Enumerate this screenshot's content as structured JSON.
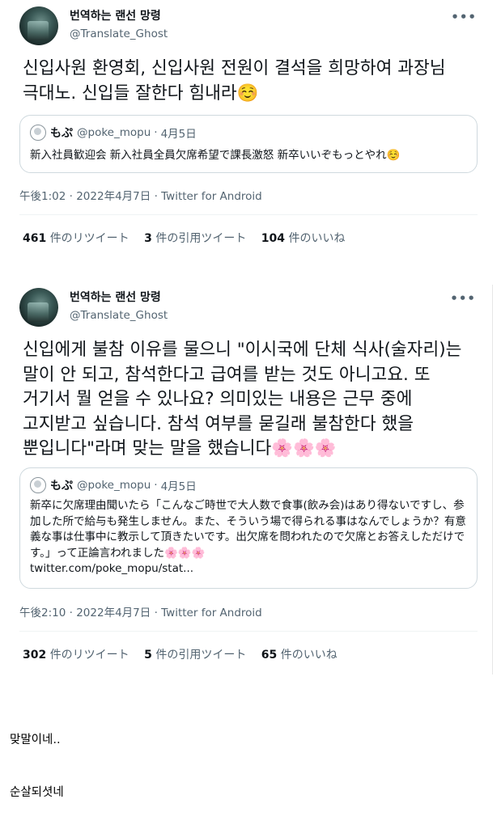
{
  "tweets": [
    {
      "display_name": "번역하는 랜선 망령",
      "handle": "@Translate_Ghost",
      "more_icon": "more-horizontal-icon",
      "more_glyph": "•••",
      "text": "신입사원 환영회, 신입사원 전원이 결석을 희망하여 과장님 극대노. 신입들 잘한다 힘내라",
      "text_emoji": "☺️",
      "quote": {
        "name": "もぷ",
        "handle": "@poke_mopu",
        "date": "4月5日",
        "body": "新入社員歓迎会 新入社員全員欠席希望で課長激怒 新卒いいぞもっとやれ",
        "body_emoji": "☺️",
        "link": ""
      },
      "meta": {
        "time": "午後1:02",
        "date": "2022年4月7日",
        "client": "Twitter for Android"
      },
      "stats": {
        "retweets": "461",
        "retweets_label": "件のリツイート",
        "quotes": "3",
        "quotes_label": "件の引用ツイート",
        "likes": "104",
        "likes_label": "件のいいね"
      }
    },
    {
      "display_name": "번역하는 랜선 망령",
      "handle": "@Translate_Ghost",
      "more_icon": "more-horizontal-icon",
      "more_glyph": "•••",
      "text": "신입에게 불참 이유를 물으니 \"이시국에 단체 식사(술자리)는 말이 안 되고, 참석한다고 급여를 받는 것도 아니고요. 또 거기서 뭘 얻을 수 있나요? 의미있는 내용은 근무 중에 고지받고 싶습니다. 참석 여부를 묻길래 불참한다 했을 뿐입니다\"라며 맞는 말을 했습니다",
      "text_emoji": "🌸🌸🌸",
      "quote": {
        "name": "もぷ",
        "handle": "@poke_mopu",
        "date": "4月5日",
        "body": "新卒に欠席理由聞いたら「こんなご時世で大人数で食事(飲み会)はあり得ないですし、参加した所で給与も発生しません。また、そういう場で得られる事はなんでしょうか？有意義な事は仕事中に教示して頂きたいです。出欠席を問われたので欠席とお答えしただけです。」って正論言われました",
        "body_emoji": "🌸🌸🌸",
        "link": "twitter.com/poke_mopu/stat..."
      },
      "meta": {
        "time": "午後2:10",
        "date": "2022年4月7日",
        "client": "Twitter for Android"
      },
      "stats": {
        "retweets": "302",
        "retweets_label": "件のリツイート",
        "quotes": "5",
        "quotes_label": "件の引用ツイート",
        "likes": "65",
        "likes_label": "件のいいね"
      }
    }
  ],
  "meta_separator": "·",
  "comments": [
    "맞말이네..",
    "순살되셧네"
  ]
}
